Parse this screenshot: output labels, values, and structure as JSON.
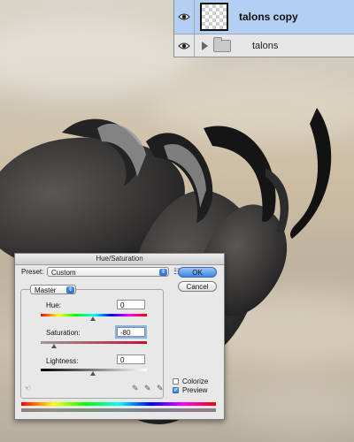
{
  "layers": {
    "items": [
      {
        "name": "talons copy",
        "selected": true,
        "icon": "eye-icon",
        "thumbnail": "transparent-thumbnail"
      },
      {
        "name": "talons",
        "selected": false,
        "icon": "folder-icon"
      }
    ]
  },
  "dialog": {
    "title": "Hue/Saturation",
    "preset_label": "Preset:",
    "preset_value": "Custom",
    "ok_label": "OK",
    "cancel_label": "Cancel",
    "channel_value": "Master",
    "hue_label": "Hue:",
    "hue_value": "0",
    "saturation_label": "Saturation:",
    "saturation_value": "-80",
    "lightness_label": "Lightness:",
    "lightness_value": "0",
    "colorize_label": "Colorize",
    "colorize_checked": false,
    "preview_label": "Preview",
    "preview_checked": true,
    "colors": {
      "ok_button": "#3b84e1",
      "hue_spectrum": [
        "#ff0000",
        "#ffff00",
        "#00ff00",
        "#00ffff",
        "#0000ff",
        "#ff00ff",
        "#ff0000"
      ],
      "saturation_track": [
        "#9a9a9a",
        "#c8102e"
      ],
      "lightness_track": [
        "#000000",
        "#ffffff"
      ]
    }
  },
  "icons": {
    "visibility": "eye-icon",
    "expand": "triangle-right-icon",
    "folder": "folder-icon",
    "hand_tool": "hand-finger-icon",
    "eyedroppers": [
      "eyedropper-icon",
      "eyedropper-plus-icon",
      "eyedropper-minus-icon"
    ]
  }
}
